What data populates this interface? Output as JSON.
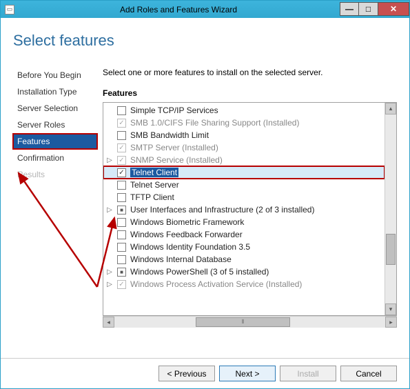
{
  "window": {
    "title": "Add Roles and Features Wizard"
  },
  "page_title": "Select features",
  "nav": {
    "items": [
      {
        "label": "Before You Begin",
        "active": false
      },
      {
        "label": "Installation Type",
        "active": false
      },
      {
        "label": "Server Selection",
        "active": false
      },
      {
        "label": "Server Roles",
        "active": false
      },
      {
        "label": "Features",
        "active": true
      },
      {
        "label": "Confirmation",
        "active": false
      },
      {
        "label": "Results",
        "active": false,
        "disabled": true
      }
    ]
  },
  "content": {
    "instruction": "Select one or more features to install on the selected server.",
    "section_label": "Features",
    "items": [
      {
        "label": "Simple TCP/IP Services",
        "checked": false,
        "installed": false
      },
      {
        "label": "SMB 1.0/CIFS File Sharing Support (Installed)",
        "checked": true,
        "installed": true
      },
      {
        "label": "SMB Bandwidth Limit",
        "checked": false,
        "installed": false
      },
      {
        "label": "SMTP Server (Installed)",
        "checked": true,
        "installed": true
      },
      {
        "label": "SNMP Service (Installed)",
        "expandable": true,
        "checked": true,
        "installed": true
      },
      {
        "label": "Telnet Client",
        "checked": true,
        "installed": false,
        "selected": true,
        "highlighted": true
      },
      {
        "label": "Telnet Server",
        "checked": false,
        "installed": false
      },
      {
        "label": "TFTP Client",
        "checked": false,
        "installed": false
      },
      {
        "label": "User Interfaces and Infrastructure (2 of 3 installed)",
        "expandable": true,
        "partial": true
      },
      {
        "label": "Windows Biometric Framework",
        "checked": false,
        "installed": false
      },
      {
        "label": "Windows Feedback Forwarder",
        "checked": false,
        "installed": false
      },
      {
        "label": "Windows Identity Foundation 3.5",
        "checked": false,
        "installed": false
      },
      {
        "label": "Windows Internal Database",
        "checked": false,
        "installed": false
      },
      {
        "label": "Windows PowerShell (3 of 5 installed)",
        "expandable": true,
        "partial": true
      },
      {
        "label": "Windows Process Activation Service (Installed)",
        "expandable": true,
        "checked": true,
        "installed": true
      }
    ]
  },
  "buttons": {
    "previous": "< Previous",
    "next": "Next >",
    "install": "Install",
    "cancel": "Cancel"
  }
}
